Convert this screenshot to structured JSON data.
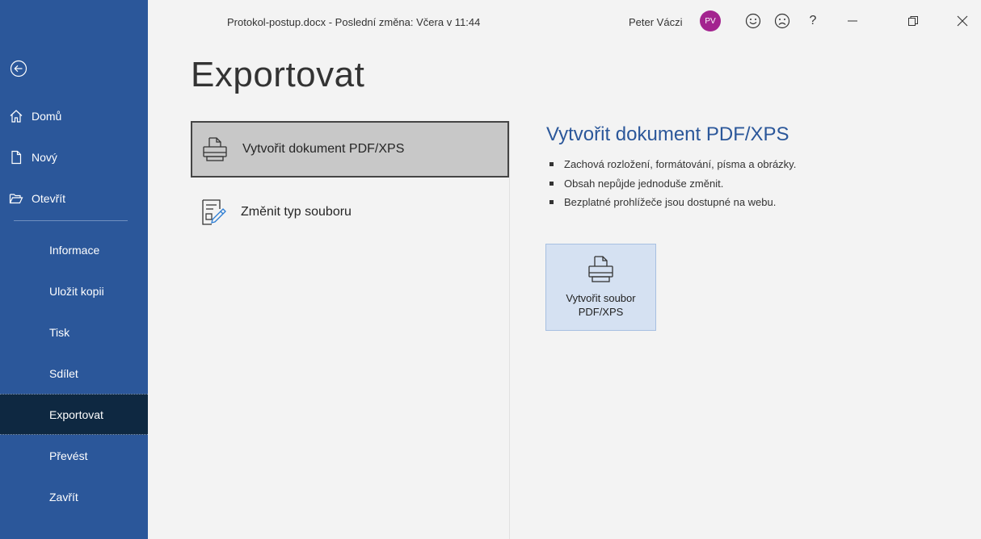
{
  "titlebar": {
    "doc_title": "Protokol-postup.docx  -  Poslední změna: Včera v 11:44",
    "user_name": "Peter Váczi",
    "avatar_initials": "PV",
    "help_label": "?"
  },
  "sidebar": {
    "top_items": [
      {
        "label": "Domů",
        "icon": "home-icon"
      },
      {
        "label": "Nový",
        "icon": "new-document-icon"
      },
      {
        "label": "Otevřít",
        "icon": "open-folder-icon"
      }
    ],
    "sub_items": [
      {
        "label": "Informace"
      },
      {
        "label": "Uložit kopii"
      },
      {
        "label": "Tisk"
      },
      {
        "label": "Sdílet"
      },
      {
        "label": "Exportovat",
        "active": true
      },
      {
        "label": "Převést"
      },
      {
        "label": "Zavřít"
      }
    ]
  },
  "main": {
    "page_title": "Exportovat",
    "options": [
      {
        "label": "Vytvořit dokument PDF/XPS",
        "selected": true,
        "icon": "pdf-document-icon"
      },
      {
        "label": "Změnit typ souboru",
        "selected": false,
        "icon": "change-file-type-icon"
      }
    ],
    "detail": {
      "title": "Vytvořit dokument PDF/XPS",
      "bullets": [
        "Zachová rozložení, formátování, písma a obrázky.",
        "Obsah nepůjde jednoduše změnit.",
        "Bezplatné prohlížeče jsou dostupné na webu."
      ],
      "button_line1": "Vytvořit soubor",
      "button_line2": "PDF/XPS"
    }
  },
  "colors": {
    "sidebar": "#2b579a",
    "sidebar_active": "#0e2841",
    "accent": "#2b579a",
    "avatar": "#a3238f",
    "button_bg": "#d5e1f2"
  }
}
